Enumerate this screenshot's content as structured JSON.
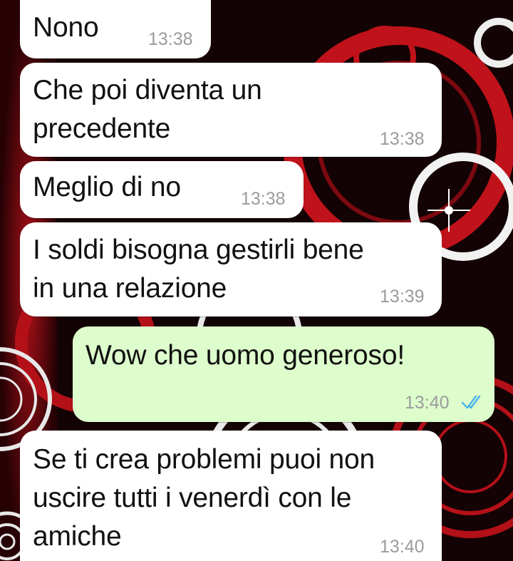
{
  "colors": {
    "incoming_bubble": "#ffffff",
    "outgoing_bubble": "#ddfdcc",
    "timestamp": "#9b9b9b",
    "read_ticks": "#4fb6ec",
    "text": "#111111"
  },
  "messages": [
    {
      "direction": "incoming",
      "text": "Nono",
      "time": "13:38"
    },
    {
      "direction": "incoming",
      "text": "Che poi diventa un\nprecedente",
      "time": "13:38"
    },
    {
      "direction": "incoming",
      "text": "Meglio di no",
      "time": "13:38"
    },
    {
      "direction": "incoming",
      "text": "I soldi bisogna gestirli bene\nin una relazione",
      "time": "13:39"
    },
    {
      "direction": "outgoing",
      "text": "Wow che uomo generoso!",
      "time": "13:40",
      "status_icon": "double-check-read-icon"
    },
    {
      "direction": "incoming",
      "text": "Se ti crea problemi puoi non\nuscire tutti i venerdì con le\namiche",
      "time": "13:40"
    }
  ]
}
